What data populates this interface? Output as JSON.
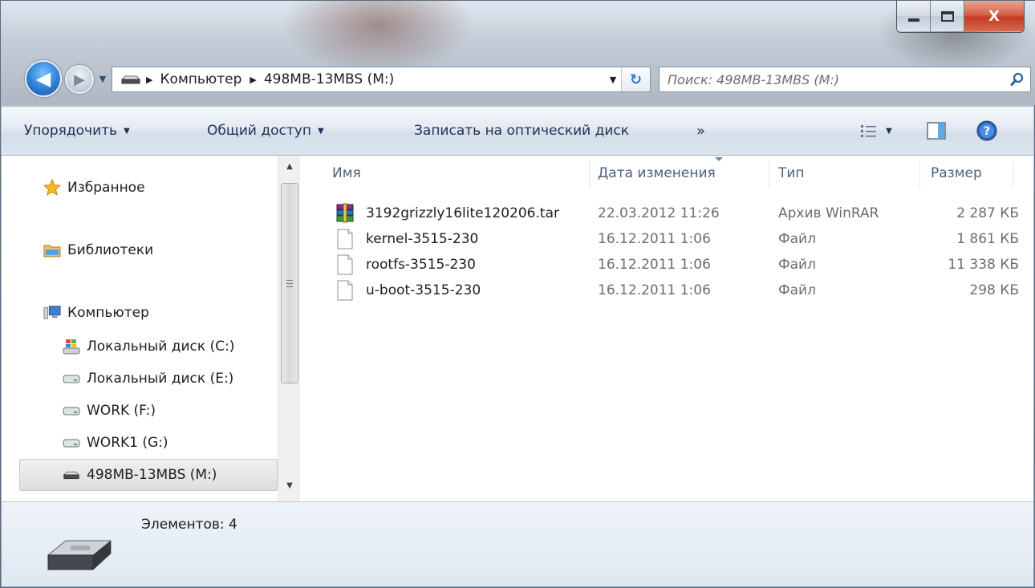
{
  "window": {
    "caption": {
      "minimize": "",
      "maximize": "",
      "close": "X"
    }
  },
  "nav": {
    "back_glyph": "◀",
    "forward_glyph": "▶",
    "history_glyph": "▼",
    "breadcrumbs": [
      "Компьютер",
      "498MB-13MBS (M:)"
    ],
    "crumb_separator": "▶",
    "address_dropdown": "▼",
    "refresh_glyph": "↻",
    "search_placeholder": "Поиск: 498MB-13MBS (M:)"
  },
  "toolbar": {
    "organize": "Упорядочить",
    "share": "Общий доступ",
    "burn": "Записать на оптический диск",
    "more": "»",
    "dropdown_glyph": "▼"
  },
  "sidebar": {
    "favorites": "Избранное",
    "libraries": "Библиотеки",
    "computer": "Компьютер",
    "drives": [
      {
        "label": "Локальный диск (C:)",
        "icon": "windows-drive-icon"
      },
      {
        "label": "Локальный диск (E:)",
        "icon": "hard-drive-icon"
      },
      {
        "label": "WORK (F:)",
        "icon": "hard-drive-icon"
      },
      {
        "label": "WORK1 (G:)",
        "icon": "hard-drive-icon"
      },
      {
        "label": "498MB-13MBS (M:)",
        "icon": "removable-drive-icon"
      }
    ],
    "selected": "498MB-13MBS (M:)"
  },
  "files": {
    "columns": {
      "name": "Имя",
      "date": "Дата изменения",
      "type": "Тип",
      "size": "Размер"
    },
    "rows": [
      {
        "name": "3192grizzly16lite120206.tar",
        "date": "22.03.2012 11:26",
        "type": "Архив WinRAR",
        "size": "2 287 КБ",
        "icon": "winrar-archive-icon"
      },
      {
        "name": "kernel-3515-230",
        "date": "16.12.2011 1:06",
        "type": "Файл",
        "size": "1 861 КБ",
        "icon": "file-icon"
      },
      {
        "name": "rootfs-3515-230",
        "date": "16.12.2011 1:06",
        "type": "Файл",
        "size": "11 338 КБ",
        "icon": "file-icon"
      },
      {
        "name": "u-boot-3515-230",
        "date": "16.12.2011 1:06",
        "type": "Файл",
        "size": "298 КБ",
        "icon": "file-icon"
      }
    ]
  },
  "status": {
    "item_count": "Элементов: 4"
  },
  "colors": {
    "toolbar_text": "#1e3154",
    "header_text": "#4c607a",
    "accent": "#2b7fd8",
    "close": "#c23b22"
  }
}
